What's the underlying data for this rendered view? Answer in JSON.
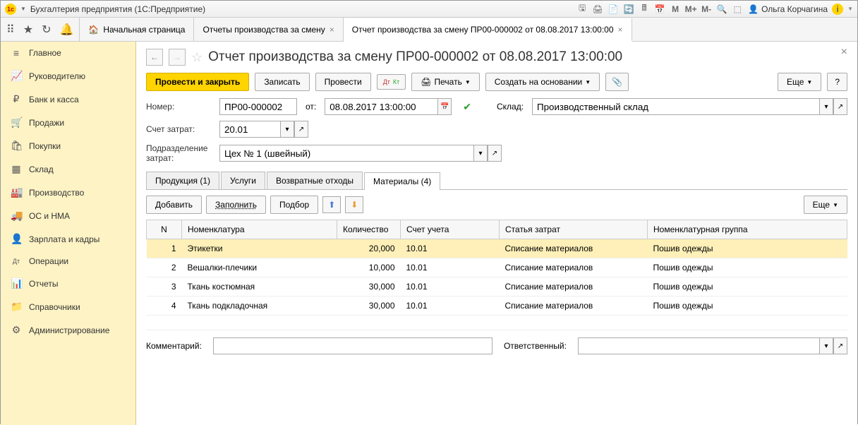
{
  "app": {
    "title": "Бухгалтерия предприятия  (1С:Предприятие)",
    "user": "Ольга Корчагина"
  },
  "topTabs": {
    "home": "Начальная страница",
    "tab1": "Отчеты производства за смену",
    "tab2": "Отчет производства за смену ПР00-000002 от 08.08.2017 13:00:00"
  },
  "sidebar": {
    "items": [
      {
        "icon": "≡",
        "label": "Главное"
      },
      {
        "icon": "📈",
        "label": "Руководителю"
      },
      {
        "icon": "₽",
        "label": "Банк и касса"
      },
      {
        "icon": "🛒",
        "label": "Продажи"
      },
      {
        "icon": "🛍",
        "label": "Покупки"
      },
      {
        "icon": "▦",
        "label": "Склад"
      },
      {
        "icon": "🏭",
        "label": "Производство"
      },
      {
        "icon": "🚚",
        "label": "ОС и НМА"
      },
      {
        "icon": "👤",
        "label": "Зарплата и кадры"
      },
      {
        "icon": "Дт",
        "label": "Операции"
      },
      {
        "icon": "📊",
        "label": "Отчеты"
      },
      {
        "icon": "📁",
        "label": "Справочники"
      },
      {
        "icon": "⚙",
        "label": "Администрирование"
      }
    ]
  },
  "doc": {
    "title": "Отчет производства за смену ПР00-000002 от 08.08.2017 13:00:00",
    "cmd": {
      "post_close": "Провести и закрыть",
      "save": "Записать",
      "post": "Провести",
      "print": "Печать",
      "create_based": "Создать на основании",
      "more": "Еще"
    },
    "form": {
      "number_label": "Номер:",
      "number_value": "ПР00-000002",
      "from_label": "от:",
      "date_value": "08.08.2017 13:00:00",
      "warehouse_label": "Склад:",
      "warehouse_value": "Производственный склад",
      "account_label": "Счет затрат:",
      "account_value": "20.01",
      "division_label": "Подразделение затрат:",
      "division_value": "Цех № 1 (швейный)"
    },
    "tabs": {
      "products": "Продукция (1)",
      "services": "Услуги",
      "returns": "Возвратные отходы",
      "materials": "Материалы (4)"
    },
    "subtoolbar": {
      "add": "Добавить",
      "fill": "Заполнить",
      "pick": "Подбор",
      "more": "Еще"
    },
    "table": {
      "headers": {
        "n": "N",
        "nomenclature": "Номенклатура",
        "qty": "Количество",
        "account": "Счет учета",
        "cost_item": "Статья затрат",
        "nom_group": "Номенклатурная группа"
      },
      "rows": [
        {
          "n": "1",
          "nom": "Этикетки",
          "qty": "20,000",
          "acc": "10.01",
          "cost": "Списание материалов",
          "grp": "Пошив одежды"
        },
        {
          "n": "2",
          "nom": "Вешалки-плечики",
          "qty": "10,000",
          "acc": "10.01",
          "cost": "Списание материалов",
          "grp": "Пошив одежды"
        },
        {
          "n": "3",
          "nom": "Ткань костюмная",
          "qty": "30,000",
          "acc": "10.01",
          "cost": "Списание материалов",
          "grp": "Пошив одежды"
        },
        {
          "n": "4",
          "nom": "Ткань подкладочная",
          "qty": "30,000",
          "acc": "10.01",
          "cost": "Списание материалов",
          "grp": "Пошив одежды"
        }
      ]
    },
    "bottom": {
      "comment_label": "Комментарий:",
      "responsible_label": "Ответственный:"
    }
  }
}
